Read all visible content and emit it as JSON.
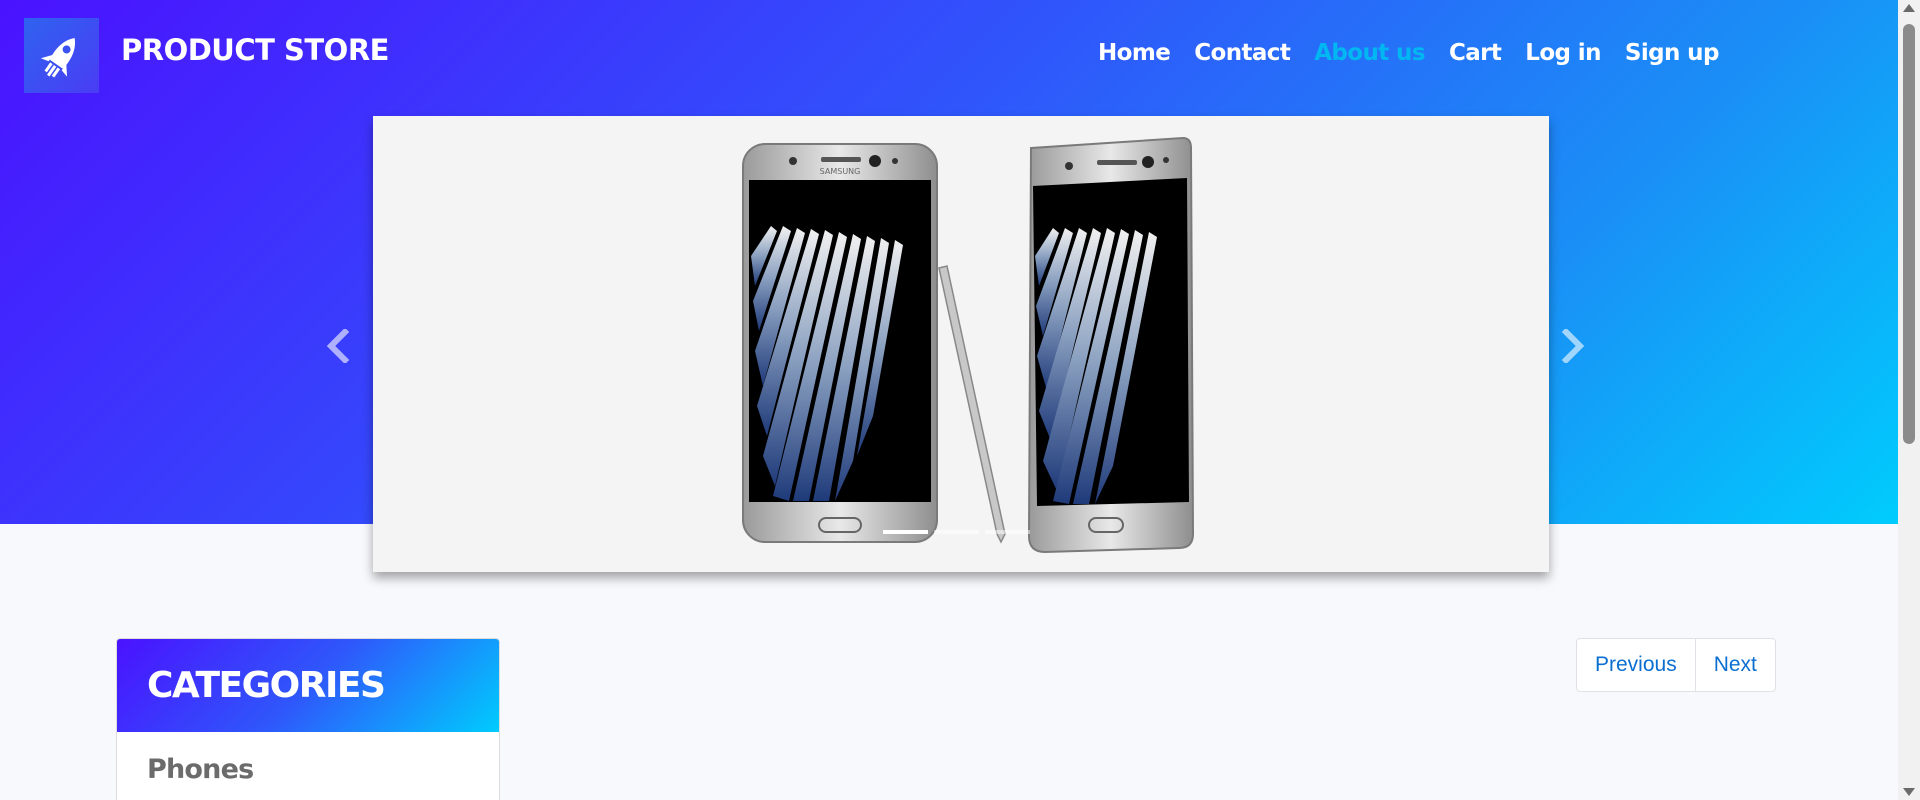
{
  "brand": {
    "name": "PRODUCT STORE",
    "logo_icon": "rocket-icon"
  },
  "nav": {
    "items": [
      {
        "label": "Home",
        "active": false
      },
      {
        "label": "Contact",
        "active": false
      },
      {
        "label": "About us",
        "active": true
      },
      {
        "label": "Cart",
        "active": false
      },
      {
        "label": "Log in",
        "active": false
      },
      {
        "label": "Sign up",
        "active": false
      }
    ]
  },
  "carousel": {
    "slide": "samsung-galaxy-note-phones-image",
    "prev_icon": "chevron-left-icon",
    "next_icon": "chevron-right-icon",
    "active_slide": 1,
    "slide_count": 3
  },
  "categories": {
    "title": "CATEGORIES",
    "items": [
      "Phones"
    ]
  },
  "pagination": {
    "previous": "Previous",
    "next": "Next"
  },
  "colors": {
    "accent_start": "#4a12ff",
    "accent_end": "#00ccfd",
    "nav_active": "#00b7f1",
    "link": "#0a6fd1"
  }
}
